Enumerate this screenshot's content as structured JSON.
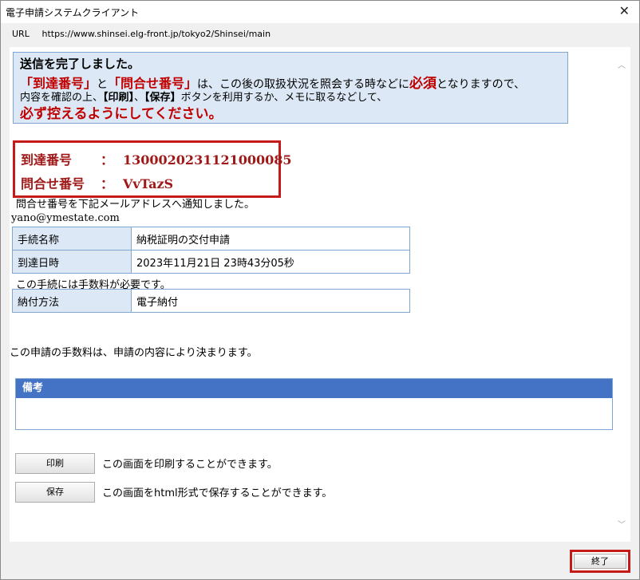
{
  "window": {
    "title": "電子申請システムクライアント",
    "close_glyph": "✕",
    "url_label": "URL",
    "url": "https://www.shinsei.elg-front.jp/tokyo2/Shinsei/main"
  },
  "notice": {
    "line1": "送信を完了しました。",
    "line2_part1": "「到達番号」",
    "line2_part2": "と",
    "line2_part3": "「問合せ番号」",
    "line2_part4": "は、この後の取扱状況を照会する時などに",
    "line2_part5": "必須",
    "line2_part6": "となりますので、",
    "line3_part1": "内容を確認の上、",
    "line3_part2": "【印刷】",
    "line3_part3": "、",
    "line3_part4": "【保存】",
    "line3_part5": "ボタンを利用するか、メモに取るなどして、",
    "line4": "必ず控えるようにしてください。"
  },
  "ids": {
    "arrival_label": "到達番号",
    "arrival_colon": "：",
    "arrival_value": "1300020231121000085",
    "inquiry_label": "問合せ番号",
    "inquiry_colon": "：",
    "inquiry_value": "VvTazS"
  },
  "email": {
    "notice": "問合せ番号を下記メールアドレスへ通知しました。",
    "address": "yano@ymestate.com"
  },
  "procedure": {
    "name_label": "手続名称",
    "name_value": "納税証明の交付申請",
    "date_label": "到達日時",
    "date_value": "2023年11月21日 23時43分05秒"
  },
  "fee": {
    "notice": "この手続には手数料が必要です。",
    "method_label": "納付方法",
    "method_value": "電子納付",
    "determination": "この申請の手数料は、申請の内容により決まります。"
  },
  "remarks": {
    "header": "備考",
    "body": ""
  },
  "actions": {
    "print_label": "印刷",
    "print_desc": "この画面を印刷することができます。",
    "save_label": "保存",
    "save_desc": "この画面をhtml形式で保存することができます。",
    "exit_label": "終了"
  },
  "scrollbar": {
    "up_glyph": "︿",
    "down_glyph": "﹀"
  },
  "colors": {
    "notice_bg": "#dce8f5",
    "accent_red": "#c41a1a",
    "remarks_header": "#4472c4"
  }
}
